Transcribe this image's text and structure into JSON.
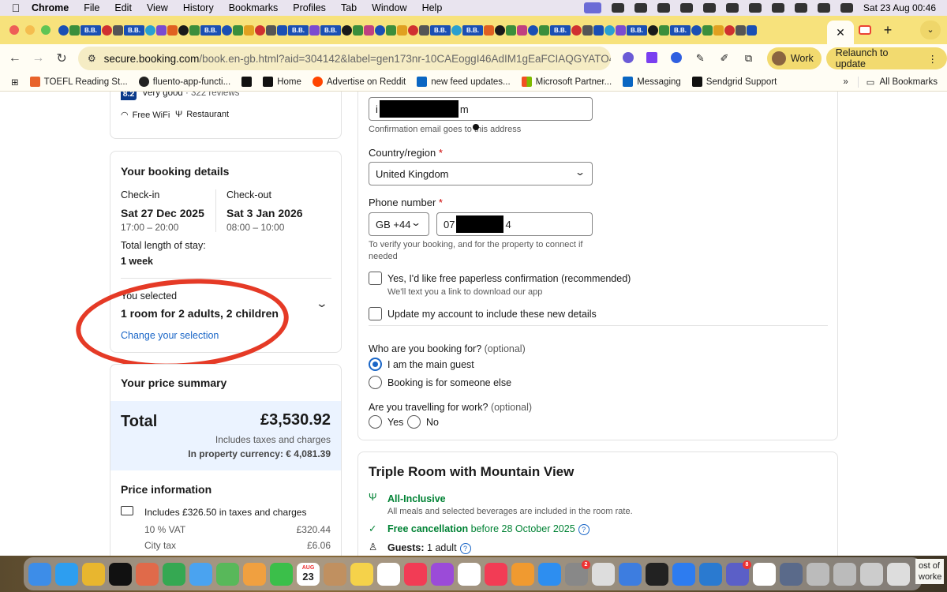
{
  "menubar": {
    "app": "Chrome",
    "items": [
      "File",
      "Edit",
      "View",
      "History",
      "Bookmarks",
      "Profiles",
      "Tab",
      "Window",
      "Help"
    ],
    "clock": "Sat 23 Aug  00:46"
  },
  "tabs": {
    "bb_label": "B.B.",
    "active_favicon": "gmail-icon",
    "new_tab": "+"
  },
  "toolbar": {
    "url_host": "secure.booking.com",
    "url_path": "/book.en-gb.html?aid=304142&label=gen173nr-10CAEoggI46AdIM1gEaFCIAQGYATO4AQfI...",
    "profile": "Work",
    "relaunch": "Relaunch to update"
  },
  "bookmarks": {
    "items": [
      {
        "label": "TOEFL Reading St...",
        "color": "#e8632b"
      },
      {
        "label": "fluento-app-functi...",
        "color": "#222222"
      },
      {
        "label": "",
        "color": "#111111"
      },
      {
        "label": "Home",
        "color": "#111111"
      },
      {
        "label": "Advertise on Reddit",
        "color": "#ff4500"
      },
      {
        "label": "new feed updates...",
        "color": "#0a66c2"
      },
      {
        "label": "Microsoft Partner...",
        "color": "#f25022"
      },
      {
        "label": "Messaging",
        "color": "#0a66c2"
      },
      {
        "label": "Sendgrid Support",
        "color": "#111111"
      }
    ],
    "all": "All Bookmarks"
  },
  "hotel": {
    "score": "8.2",
    "score_text": "Very good",
    "reviews": "· 322 reviews",
    "amenity_wifi": "Free WiFi",
    "amenity_restaurant": "Restaurant"
  },
  "booking": {
    "title": "Your booking details",
    "checkin_label": "Check-in",
    "checkin_date": "Sat 27 Dec 2025",
    "checkin_time": "17:00 – 20:00",
    "checkout_label": "Check-out",
    "checkout_date": "Sat 3 Jan 2026",
    "checkout_time": "08:00 – 10:00",
    "stay_label": "Total length of stay:",
    "stay_value": "1 week",
    "selected_label": "You selected",
    "selected_value": "1 room for 2 adults, 2 children",
    "change_link": "Change your selection"
  },
  "price": {
    "title": "Your price summary",
    "total_label": "Total",
    "total_value": "£3,530.92",
    "includes": "Includes taxes and charges",
    "property_currency": "In property currency: € 4,081.39",
    "info_title": "Price information",
    "taxes_line": "Includes £326.50 in taxes and charges",
    "rows": [
      {
        "label": "10 % VAT",
        "value": "£320.44"
      },
      {
        "label": "City tax",
        "value": "£6.06"
      }
    ]
  },
  "form": {
    "email_prefix": "i",
    "email_suffix": "m",
    "email_help": "Confirmation email goes to this address",
    "country_label": "Country/region",
    "required_mark": "*",
    "country_value": "United Kingdom",
    "phone_label": "Phone number",
    "phone_code": "GB +44",
    "phone_prefix": "07",
    "phone_suffix": "4",
    "phone_help_1": "To verify your booking, and for the property to connect if",
    "phone_help_2": "needed",
    "paperless_label": "Yes, I'd like free paperless confirmation (recommended)",
    "paperless_sub": "We'll text you a link to download our app",
    "update_account": "Update my account to include these new details",
    "booking_for_q": "Who are you booking for?",
    "optional": "(optional)",
    "main_guest": "I am the main guest",
    "someone_else": "Booking is for someone else",
    "work_q": "Are you travelling for work?",
    "yes": "Yes",
    "no": "No"
  },
  "room": {
    "title": "Triple Room with Mountain View",
    "meal": "All-Inclusive",
    "meal_sub": "All meals and selected beverages are included in the room rate.",
    "cancel": "Free cancellation",
    "cancel_rest": "before 28 October 2025",
    "guests_label": "Guests:",
    "guests_value": "1 adult"
  },
  "dock": {
    "calendar_month": "AUG",
    "calendar_day": "23",
    "badge_teams": "8",
    "badge_settings": "2",
    "corner_text": "ost of worke"
  }
}
